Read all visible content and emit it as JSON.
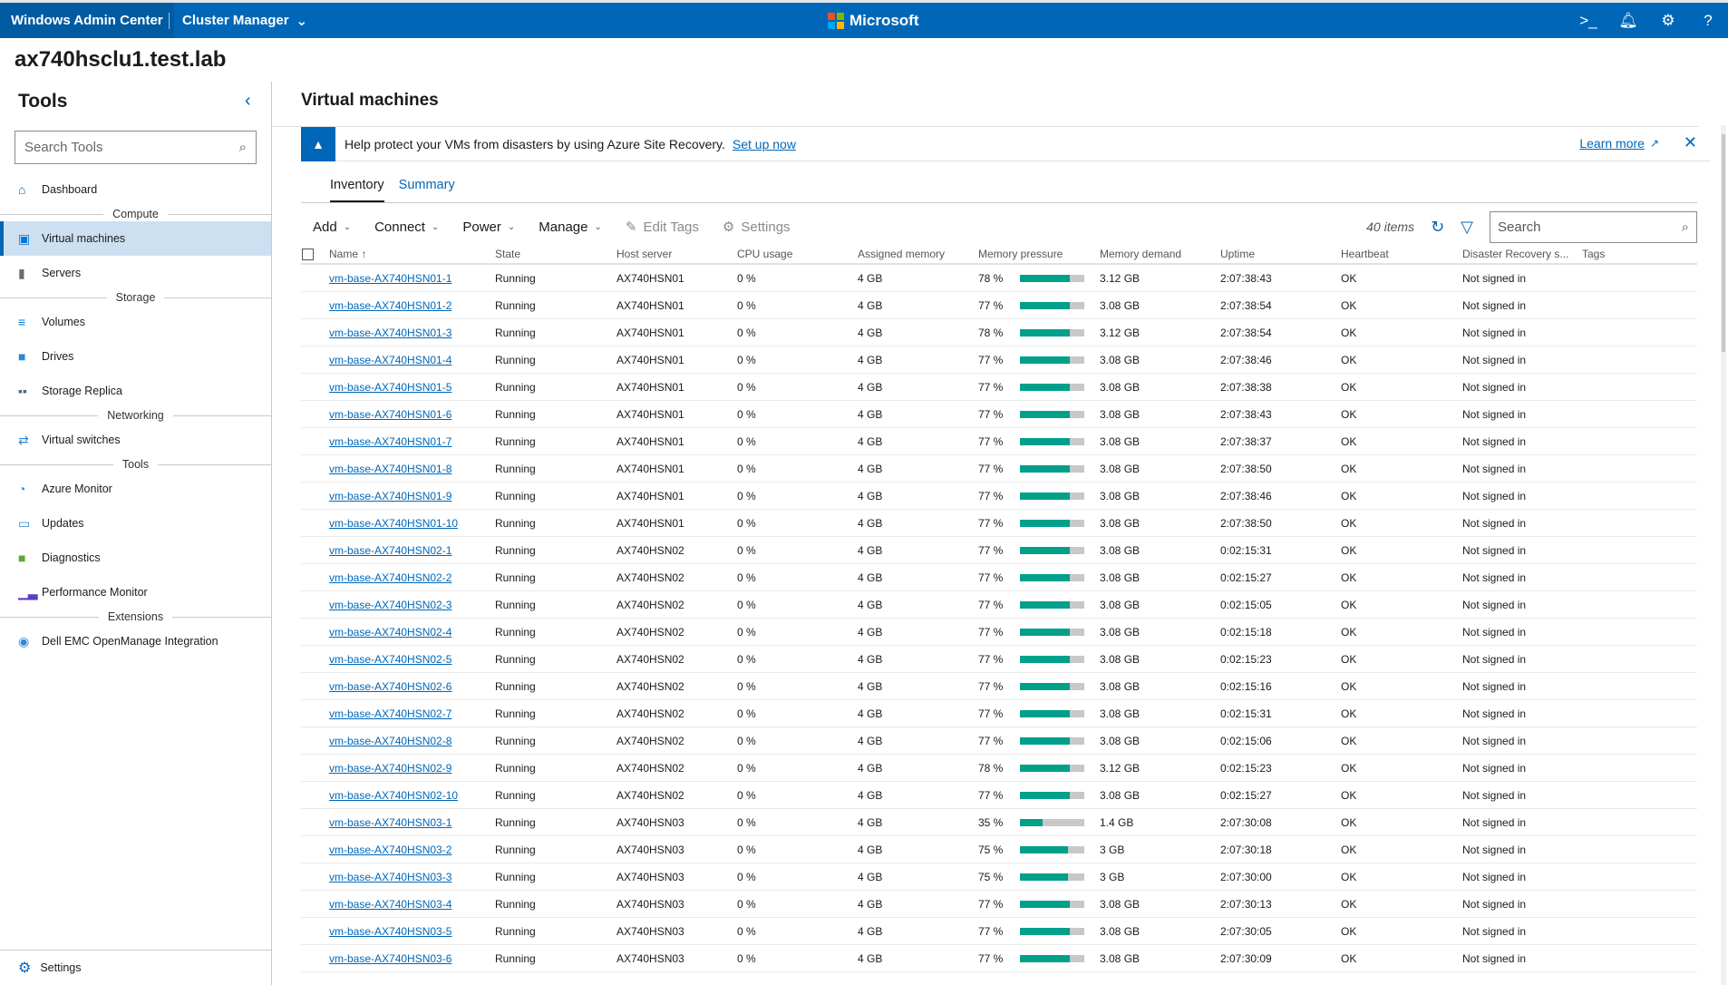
{
  "topbar": {
    "app_title": "Windows Admin Center",
    "context_menu": "Cluster Manager",
    "brand": "Microsoft",
    "icons": [
      "powershell-icon",
      "notifications-icon",
      "settings-icon",
      "help-icon"
    ]
  },
  "cluster_name": "ax740hsclu1.test.lab",
  "sidebar": {
    "title": "Tools",
    "search_placeholder": "Search Tools",
    "items": [
      {
        "type": "item",
        "label": "Dashboard",
        "icon": "home-icon"
      },
      {
        "type": "group",
        "label": "Compute"
      },
      {
        "type": "item",
        "label": "Virtual machines",
        "icon": "virtual-machine-icon",
        "active": true
      },
      {
        "type": "item",
        "label": "Servers",
        "icon": "server-icon"
      },
      {
        "type": "group",
        "label": "Storage"
      },
      {
        "type": "item",
        "label": "Volumes",
        "icon": "volumes-icon"
      },
      {
        "type": "item",
        "label": "Drives",
        "icon": "drive-icon"
      },
      {
        "type": "item",
        "label": "Storage Replica",
        "icon": "storage-replica-icon"
      },
      {
        "type": "group",
        "label": "Networking"
      },
      {
        "type": "item",
        "label": "Virtual switches",
        "icon": "virtual-switch-icon"
      },
      {
        "type": "group",
        "label": "Tools"
      },
      {
        "type": "item",
        "label": "Azure Monitor",
        "icon": "azure-monitor-icon"
      },
      {
        "type": "item",
        "label": "Updates",
        "icon": "updates-icon"
      },
      {
        "type": "item",
        "label": "Diagnostics",
        "icon": "diagnostics-icon"
      },
      {
        "type": "item",
        "label": "Performance Monitor",
        "icon": "performance-monitor-icon"
      },
      {
        "type": "group",
        "label": "Extensions"
      },
      {
        "type": "item",
        "label": "Dell EMC OpenManage Integration",
        "icon": "openmanage-icon"
      }
    ],
    "footer_label": "Settings"
  },
  "main": {
    "title": "Virtual machines",
    "banner": {
      "text": "Help protect your VMs from disasters by using Azure Site Recovery.",
      "link": "Set up now",
      "learn_more": "Learn more"
    },
    "tabs": [
      {
        "label": "Inventory",
        "active": true
      },
      {
        "label": "Summary",
        "active": false
      }
    ],
    "toolbar": {
      "add": "Add",
      "connect": "Connect",
      "power": "Power",
      "manage": "Manage",
      "edit_tags": "Edit Tags",
      "settings": "Settings",
      "items_count": "40 items",
      "search_placeholder": "Search"
    },
    "columns": [
      "Name",
      "State",
      "Host server",
      "CPU usage",
      "Assigned memory",
      "Memory pressure",
      "Memory demand",
      "Uptime",
      "Heartbeat",
      "Disaster Recovery s...",
      "Tags"
    ],
    "rows": [
      {
        "name": "vm-base-AX740HSN01-1",
        "state": "Running",
        "host": "AX740HSN01",
        "cpu": "0 %",
        "assigned": "4 GB",
        "pressure": 78,
        "demand": "3.12 GB",
        "uptime": "2:07:38:43",
        "heartbeat": "OK",
        "dr": "Not signed in",
        "tags": ""
      },
      {
        "name": "vm-base-AX740HSN01-2",
        "state": "Running",
        "host": "AX740HSN01",
        "cpu": "0 %",
        "assigned": "4 GB",
        "pressure": 77,
        "demand": "3.08 GB",
        "uptime": "2:07:38:54",
        "heartbeat": "OK",
        "dr": "Not signed in",
        "tags": ""
      },
      {
        "name": "vm-base-AX740HSN01-3",
        "state": "Running",
        "host": "AX740HSN01",
        "cpu": "0 %",
        "assigned": "4 GB",
        "pressure": 78,
        "demand": "3.12 GB",
        "uptime": "2:07:38:54",
        "heartbeat": "OK",
        "dr": "Not signed in",
        "tags": ""
      },
      {
        "name": "vm-base-AX740HSN01-4",
        "state": "Running",
        "host": "AX740HSN01",
        "cpu": "0 %",
        "assigned": "4 GB",
        "pressure": 77,
        "demand": "3.08 GB",
        "uptime": "2:07:38:46",
        "heartbeat": "OK",
        "dr": "Not signed in",
        "tags": ""
      },
      {
        "name": "vm-base-AX740HSN01-5",
        "state": "Running",
        "host": "AX740HSN01",
        "cpu": "0 %",
        "assigned": "4 GB",
        "pressure": 77,
        "demand": "3.08 GB",
        "uptime": "2:07:38:38",
        "heartbeat": "OK",
        "dr": "Not signed in",
        "tags": ""
      },
      {
        "name": "vm-base-AX740HSN01-6",
        "state": "Running",
        "host": "AX740HSN01",
        "cpu": "0 %",
        "assigned": "4 GB",
        "pressure": 77,
        "demand": "3.08 GB",
        "uptime": "2:07:38:43",
        "heartbeat": "OK",
        "dr": "Not signed in",
        "tags": ""
      },
      {
        "name": "vm-base-AX740HSN01-7",
        "state": "Running",
        "host": "AX740HSN01",
        "cpu": "0 %",
        "assigned": "4 GB",
        "pressure": 77,
        "demand": "3.08 GB",
        "uptime": "2:07:38:37",
        "heartbeat": "OK",
        "dr": "Not signed in",
        "tags": ""
      },
      {
        "name": "vm-base-AX740HSN01-8",
        "state": "Running",
        "host": "AX740HSN01",
        "cpu": "0 %",
        "assigned": "4 GB",
        "pressure": 77,
        "demand": "3.08 GB",
        "uptime": "2:07:38:50",
        "heartbeat": "OK",
        "dr": "Not signed in",
        "tags": ""
      },
      {
        "name": "vm-base-AX740HSN01-9",
        "state": "Running",
        "host": "AX740HSN01",
        "cpu": "0 %",
        "assigned": "4 GB",
        "pressure": 77,
        "demand": "3.08 GB",
        "uptime": "2:07:38:46",
        "heartbeat": "OK",
        "dr": "Not signed in",
        "tags": ""
      },
      {
        "name": "vm-base-AX740HSN01-10",
        "state": "Running",
        "host": "AX740HSN01",
        "cpu": "0 %",
        "assigned": "4 GB",
        "pressure": 77,
        "demand": "3.08 GB",
        "uptime": "2:07:38:50",
        "heartbeat": "OK",
        "dr": "Not signed in",
        "tags": ""
      },
      {
        "name": "vm-base-AX740HSN02-1",
        "state": "Running",
        "host": "AX740HSN02",
        "cpu": "0 %",
        "assigned": "4 GB",
        "pressure": 77,
        "demand": "3.08 GB",
        "uptime": "0:02:15:31",
        "heartbeat": "OK",
        "dr": "Not signed in",
        "tags": ""
      },
      {
        "name": "vm-base-AX740HSN02-2",
        "state": "Running",
        "host": "AX740HSN02",
        "cpu": "0 %",
        "assigned": "4 GB",
        "pressure": 77,
        "demand": "3.08 GB",
        "uptime": "0:02:15:27",
        "heartbeat": "OK",
        "dr": "Not signed in",
        "tags": ""
      },
      {
        "name": "vm-base-AX740HSN02-3",
        "state": "Running",
        "host": "AX740HSN02",
        "cpu": "0 %",
        "assigned": "4 GB",
        "pressure": 77,
        "demand": "3.08 GB",
        "uptime": "0:02:15:05",
        "heartbeat": "OK",
        "dr": "Not signed in",
        "tags": ""
      },
      {
        "name": "vm-base-AX740HSN02-4",
        "state": "Running",
        "host": "AX740HSN02",
        "cpu": "0 %",
        "assigned": "4 GB",
        "pressure": 77,
        "demand": "3.08 GB",
        "uptime": "0:02:15:18",
        "heartbeat": "OK",
        "dr": "Not signed in",
        "tags": ""
      },
      {
        "name": "vm-base-AX740HSN02-5",
        "state": "Running",
        "host": "AX740HSN02",
        "cpu": "0 %",
        "assigned": "4 GB",
        "pressure": 77,
        "demand": "3.08 GB",
        "uptime": "0:02:15:23",
        "heartbeat": "OK",
        "dr": "Not signed in",
        "tags": ""
      },
      {
        "name": "vm-base-AX740HSN02-6",
        "state": "Running",
        "host": "AX740HSN02",
        "cpu": "0 %",
        "assigned": "4 GB",
        "pressure": 77,
        "demand": "3.08 GB",
        "uptime": "0:02:15:16",
        "heartbeat": "OK",
        "dr": "Not signed in",
        "tags": ""
      },
      {
        "name": "vm-base-AX740HSN02-7",
        "state": "Running",
        "host": "AX740HSN02",
        "cpu": "0 %",
        "assigned": "4 GB",
        "pressure": 77,
        "demand": "3.08 GB",
        "uptime": "0:02:15:31",
        "heartbeat": "OK",
        "dr": "Not signed in",
        "tags": ""
      },
      {
        "name": "vm-base-AX740HSN02-8",
        "state": "Running",
        "host": "AX740HSN02",
        "cpu": "0 %",
        "assigned": "4 GB",
        "pressure": 77,
        "demand": "3.08 GB",
        "uptime": "0:02:15:06",
        "heartbeat": "OK",
        "dr": "Not signed in",
        "tags": ""
      },
      {
        "name": "vm-base-AX740HSN02-9",
        "state": "Running",
        "host": "AX740HSN02",
        "cpu": "0 %",
        "assigned": "4 GB",
        "pressure": 78,
        "demand": "3.12 GB",
        "uptime": "0:02:15:23",
        "heartbeat": "OK",
        "dr": "Not signed in",
        "tags": ""
      },
      {
        "name": "vm-base-AX740HSN02-10",
        "state": "Running",
        "host": "AX740HSN02",
        "cpu": "0 %",
        "assigned": "4 GB",
        "pressure": 77,
        "demand": "3.08 GB",
        "uptime": "0:02:15:27",
        "heartbeat": "OK",
        "dr": "Not signed in",
        "tags": ""
      },
      {
        "name": "vm-base-AX740HSN03-1",
        "state": "Running",
        "host": "AX740HSN03",
        "cpu": "0 %",
        "assigned": "4 GB",
        "pressure": 35,
        "demand": "1.4 GB",
        "uptime": "2:07:30:08",
        "heartbeat": "OK",
        "dr": "Not signed in",
        "tags": ""
      },
      {
        "name": "vm-base-AX740HSN03-2",
        "state": "Running",
        "host": "AX740HSN03",
        "cpu": "0 %",
        "assigned": "4 GB",
        "pressure": 75,
        "demand": "3 GB",
        "uptime": "2:07:30:18",
        "heartbeat": "OK",
        "dr": "Not signed in",
        "tags": ""
      },
      {
        "name": "vm-base-AX740HSN03-3",
        "state": "Running",
        "host": "AX740HSN03",
        "cpu": "0 %",
        "assigned": "4 GB",
        "pressure": 75,
        "demand": "3 GB",
        "uptime": "2:07:30:00",
        "heartbeat": "OK",
        "dr": "Not signed in",
        "tags": ""
      },
      {
        "name": "vm-base-AX740HSN03-4",
        "state": "Running",
        "host": "AX740HSN03",
        "cpu": "0 %",
        "assigned": "4 GB",
        "pressure": 77,
        "demand": "3.08 GB",
        "uptime": "2:07:30:13",
        "heartbeat": "OK",
        "dr": "Not signed in",
        "tags": ""
      },
      {
        "name": "vm-base-AX740HSN03-5",
        "state": "Running",
        "host": "AX740HSN03",
        "cpu": "0 %",
        "assigned": "4 GB",
        "pressure": 77,
        "demand": "3.08 GB",
        "uptime": "2:07:30:05",
        "heartbeat": "OK",
        "dr": "Not signed in",
        "tags": ""
      },
      {
        "name": "vm-base-AX740HSN03-6",
        "state": "Running",
        "host": "AX740HSN03",
        "cpu": "0 %",
        "assigned": "4 GB",
        "pressure": 77,
        "demand": "3.08 GB",
        "uptime": "2:07:30:09",
        "heartbeat": "OK",
        "dr": "Not signed in",
        "tags": ""
      }
    ]
  },
  "colors": {
    "brand_blue": "#0067b8",
    "pressure_fill": "#00a08a",
    "pressure_track": "#c8c8c8",
    "active_nav": "#cce0f2"
  }
}
